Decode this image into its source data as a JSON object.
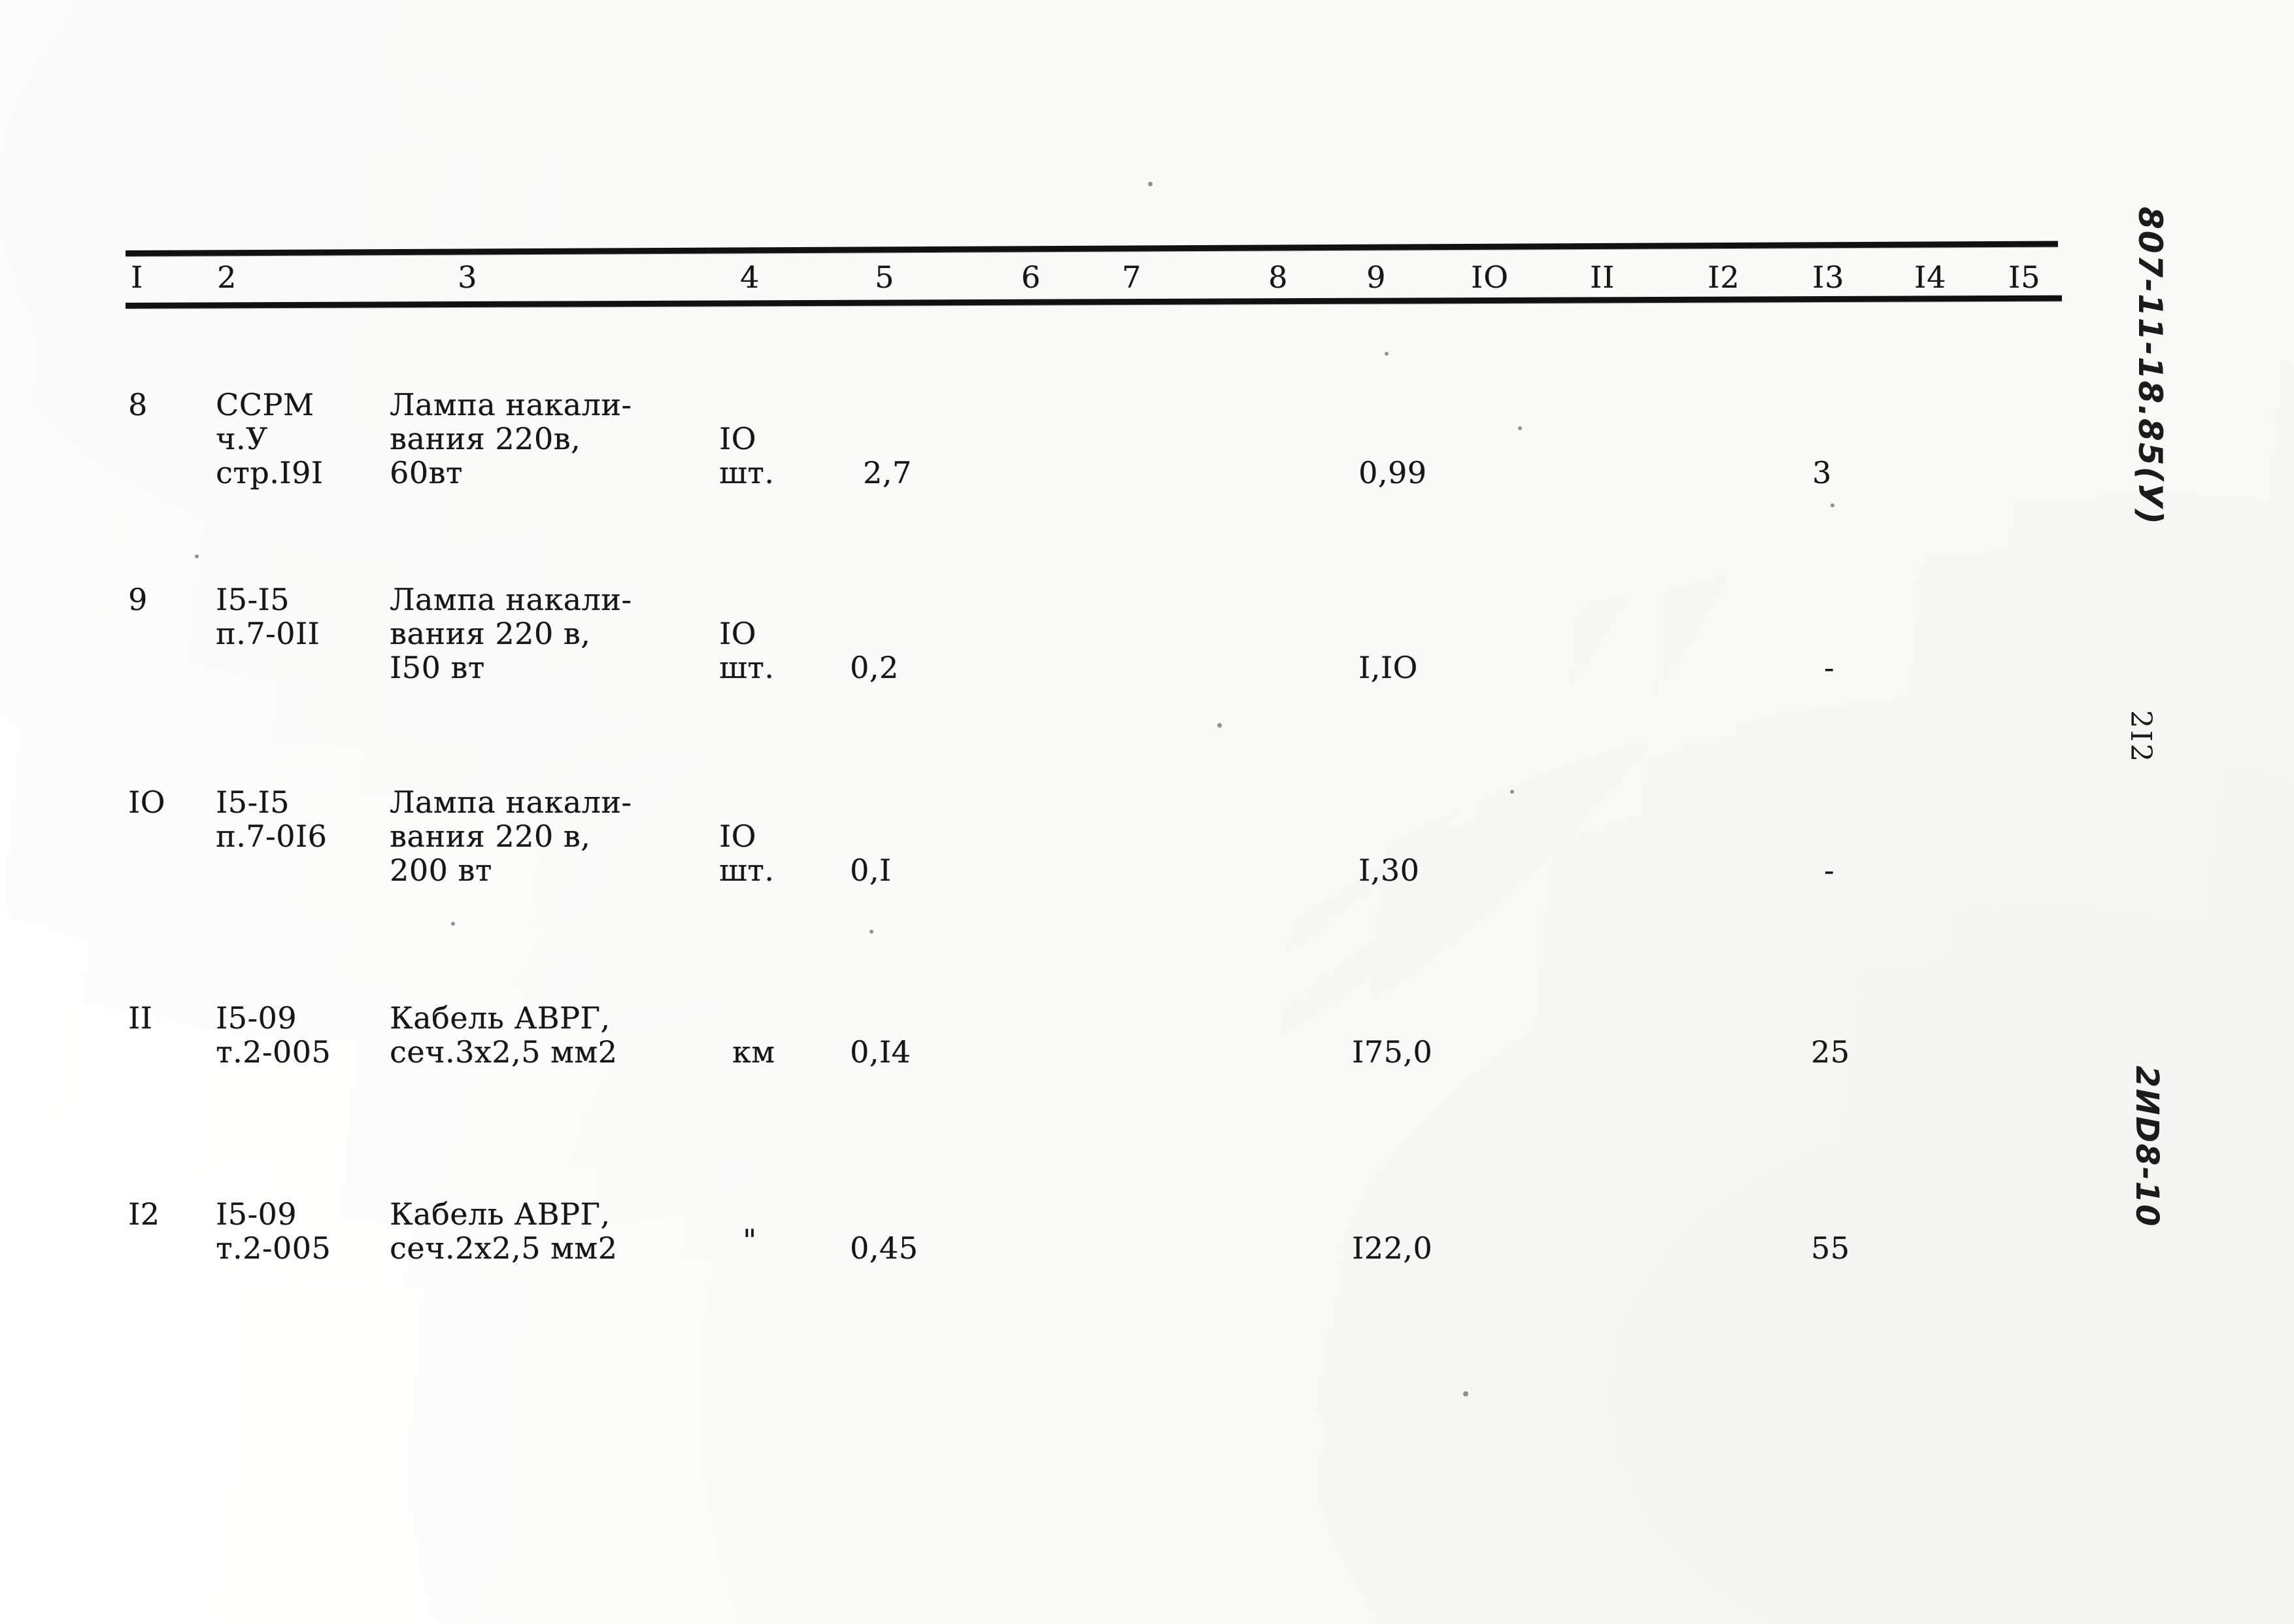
{
  "document": {
    "type": "typewritten-cost-table-scan",
    "language": "ru"
  },
  "table": {
    "column_headers": [
      "I",
      "2",
      "3",
      "4",
      "5",
      "6",
      "7",
      "8",
      "9",
      "IO",
      "II",
      "I2",
      "I3",
      "I4",
      "I5"
    ],
    "rows": [
      {
        "no": "8",
        "code": [
          "ССРМ",
          "ч.У",
          "стр.I9I"
        ],
        "name": [
          "Лампа накали-",
          "вания 220в,",
          "60вт"
        ],
        "unit": [
          "IO",
          "шт."
        ],
        "qty": "2,7",
        "c6": "",
        "c7": "",
        "c8": "",
        "c9": "0,99",
        "c10": "",
        "c11": "",
        "c12": "",
        "c13": "3",
        "c14": "",
        "c15": ""
      },
      {
        "no": "9",
        "code": [
          "I5-I5",
          "п.7-0II"
        ],
        "name": [
          "Лампа накали-",
          "вания 220 в,",
          "I50 вт"
        ],
        "unit": [
          "IO",
          "шт."
        ],
        "qty": "0,2",
        "c6": "",
        "c7": "",
        "c8": "",
        "c9": "I,IO",
        "c10": "",
        "c11": "",
        "c12": "",
        "c13": "-",
        "c14": "",
        "c15": ""
      },
      {
        "no": "IO",
        "code": [
          "I5-I5",
          "п.7-0I6"
        ],
        "name": [
          "Лампа накали-",
          "вания 220 в,",
          "200 вт"
        ],
        "unit": [
          "IO",
          "шт."
        ],
        "qty": "0,I",
        "c6": "",
        "c7": "",
        "c8": "",
        "c9": "I,30",
        "c10": "",
        "c11": "",
        "c12": "",
        "c13": "-",
        "c14": "",
        "c15": ""
      },
      {
        "no": "II",
        "code": [
          "I5-09",
          "т.2-005"
        ],
        "name": [
          "Кабель АВРГ,",
          "сеч.3х2,5 мм2"
        ],
        "unit": [
          "",
          "км"
        ],
        "qty": "0,I4",
        "c6": "",
        "c7": "",
        "c8": "",
        "c9": "I75,0",
        "c10": "",
        "c11": "",
        "c12": "",
        "c13": "25",
        "c14": "",
        "c15": ""
      },
      {
        "no": "I2",
        "code": [
          "I5-09",
          "т.2-005"
        ],
        "name": [
          "Кабель АВРГ,",
          "сеч.2х2,5 мм2"
        ],
        "unit": [
          "",
          "\""
        ],
        "qty": "0,45",
        "c6": "",
        "c7": "",
        "c8": "",
        "c9": "I22,0",
        "c10": "",
        "c11": "",
        "c12": "",
        "c13": "55",
        "c14": "",
        "c15": ""
      }
    ]
  },
  "margin_notes": {
    "code": "807-11-18.85(У)",
    "page": "2I2",
    "reference": "2ИD8-10"
  }
}
